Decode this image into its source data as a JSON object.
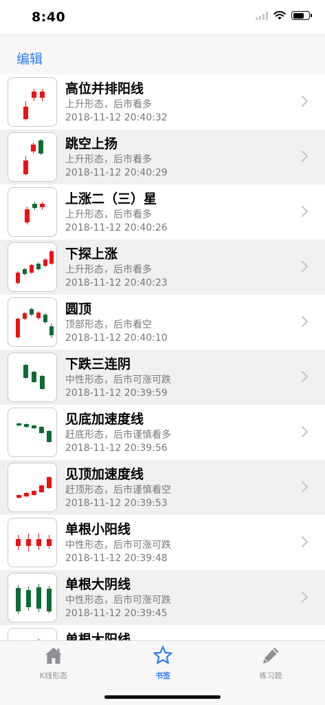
{
  "status": {
    "time": "8:40"
  },
  "nav": {
    "edit_label": "编辑"
  },
  "colors": {
    "up": "#ee1111",
    "down": "#0e6b34",
    "accent": "#2f7cf6"
  },
  "items": [
    {
      "title": "高位并排阳线",
      "subtitle": "上升形态，后市看多",
      "time": "2018-11-12 20:40:32",
      "icon": "side-by-side-white-lines-icon",
      "candles": [
        {
          "x": 22,
          "bt": 42,
          "bb": 60,
          "wt": 34,
          "wb": 62,
          "c": "up"
        },
        {
          "x": 34,
          "bt": 20,
          "bb": 29,
          "wt": 16,
          "wb": 34,
          "c": "up"
        },
        {
          "x": 46,
          "bt": 20,
          "bb": 29,
          "wt": 16,
          "wb": 34,
          "c": "up"
        }
      ]
    },
    {
      "title": "跳空上扬",
      "subtitle": "上升形态，后市看多",
      "time": "2018-11-12 20:40:29",
      "icon": "upside-gap-icon",
      "candles": [
        {
          "x": 22,
          "bt": 40,
          "bb": 60,
          "wt": 34,
          "wb": 62,
          "c": "up"
        },
        {
          "x": 33,
          "bt": 17,
          "bb": 27,
          "wt": 14,
          "wb": 30,
          "c": "up"
        },
        {
          "x": 44,
          "bt": 11,
          "bb": 30,
          "wt": 9,
          "wb": 32,
          "c": "down"
        }
      ]
    },
    {
      "title": "上涨二（三）星",
      "subtitle": "上升形态，后市看多",
      "time": "2018-11-12 20:40:26",
      "icon": "rising-stars-icon",
      "candles": [
        {
          "x": 24,
          "bt": 31,
          "bb": 50,
          "wt": 27,
          "wb": 53,
          "c": "up"
        },
        {
          "x": 35,
          "bt": 23,
          "bb": 29,
          "wt": 20,
          "wb": 32,
          "c": "down"
        },
        {
          "x": 46,
          "bt": 23,
          "bb": 28,
          "wt": 20,
          "wb": 32,
          "c": "up"
        }
      ]
    },
    {
      "title": "下探上涨",
      "subtitle": "上升形态，后市看多",
      "time": "2018-11-12 20:40:23",
      "icon": "dip-and-rise-icon",
      "candles": [
        {
          "x": 11,
          "bt": 43,
          "bb": 58,
          "wt": 41,
          "wb": 60,
          "c": "up"
        },
        {
          "x": 21,
          "bt": 38,
          "bb": 45,
          "wt": 36,
          "wb": 47,
          "c": "down"
        },
        {
          "x": 31,
          "bt": 32,
          "bb": 43,
          "wt": 30,
          "wb": 45,
          "c": "up"
        },
        {
          "x": 41,
          "bt": 30,
          "bb": 38,
          "wt": 28,
          "wb": 40,
          "c": "down"
        },
        {
          "x": 51,
          "bt": 24,
          "bb": 33,
          "wt": 22,
          "wb": 35,
          "c": "up"
        },
        {
          "x": 60,
          "bt": 12,
          "bb": 30,
          "wt": 10,
          "wb": 32,
          "c": "up"
        }
      ]
    },
    {
      "title": "圆顶",
      "subtitle": "顶部形态，后市看空",
      "time": "2018-11-12 20:40:10",
      "icon": "rounded-top-icon",
      "candles": [
        {
          "x": 11,
          "bt": 30,
          "bb": 57,
          "wt": 28,
          "wb": 59,
          "c": "up"
        },
        {
          "x": 21,
          "bt": 22,
          "bb": 30,
          "wt": 20,
          "wb": 32,
          "c": "up"
        },
        {
          "x": 31,
          "bt": 16,
          "bb": 24,
          "wt": 14,
          "wb": 26,
          "c": "down"
        },
        {
          "x": 41,
          "bt": 21,
          "bb": 29,
          "wt": 19,
          "wb": 31,
          "c": "up"
        },
        {
          "x": 51,
          "bt": 24,
          "bb": 35,
          "wt": 22,
          "wb": 37,
          "c": "down"
        },
        {
          "x": 60,
          "bt": 41,
          "bb": 54,
          "wt": 37,
          "wb": 58,
          "c": "down"
        }
      ]
    },
    {
      "title": "下跌三连阴",
      "subtitle": "中性形态，后市可涨可跌",
      "time": "2018-11-12 20:39:59",
      "icon": "three-black-crows-icon",
      "candles": [
        {
          "x": 22,
          "bt": 17,
          "bb": 36,
          "wt": 16,
          "wb": 37,
          "c": "down"
        },
        {
          "x": 34,
          "bt": 27,
          "bb": 42,
          "wt": 26,
          "wb": 43,
          "c": "down"
        },
        {
          "x": 46,
          "bt": 33,
          "bb": 52,
          "wt": 32,
          "wb": 53,
          "c": "down"
        }
      ]
    },
    {
      "title": "见底加速度线",
      "subtitle": "赶底形态，后市谨慎看多",
      "time": "2018-11-12 20:39:56",
      "icon": "bottom-acceleration-icon",
      "candles": [
        {
          "x": 12,
          "bt": 22,
          "bb": 25,
          "wt": 21,
          "wb": 26,
          "c": "down"
        },
        {
          "x": 23,
          "bt": 23,
          "bb": 27,
          "wt": 22,
          "wb": 28,
          "c": "down"
        },
        {
          "x": 34,
          "bt": 25,
          "bb": 29,
          "wt": 24,
          "wb": 30,
          "c": "down"
        },
        {
          "x": 45,
          "bt": 27,
          "bb": 36,
          "wt": 26,
          "wb": 37,
          "c": "down"
        },
        {
          "x": 56,
          "bt": 33,
          "bb": 49,
          "wt": 32,
          "wb": 50,
          "c": "down"
        }
      ]
    },
    {
      "title": "见顶加速度线",
      "subtitle": "赶顶形态，后市谨慎看空",
      "time": "2018-11-12 20:39:53",
      "icon": "top-acceleration-icon",
      "candles": [
        {
          "x": 12,
          "bt": 46,
          "bb": 50,
          "wt": 45,
          "wb": 51,
          "c": "up"
        },
        {
          "x": 23,
          "bt": 43,
          "bb": 48,
          "wt": 42,
          "wb": 49,
          "c": "up"
        },
        {
          "x": 34,
          "bt": 40,
          "bb": 46,
          "wt": 39,
          "wb": 47,
          "c": "up"
        },
        {
          "x": 45,
          "bt": 32,
          "bb": 42,
          "wt": 31,
          "wb": 43,
          "c": "up"
        },
        {
          "x": 56,
          "bt": 20,
          "bb": 36,
          "wt": 19,
          "wb": 37,
          "c": "up"
        }
      ]
    },
    {
      "title": "单根小阳线",
      "subtitle": "中性形态，后市可涨可跌",
      "time": "2018-11-12 20:39:48",
      "icon": "single-small-white-line-icon",
      "candles": [
        {
          "x": 11,
          "bt": 30,
          "bb": 40,
          "wt": 24,
          "wb": 46,
          "c": "up"
        },
        {
          "x": 26,
          "bt": 30,
          "bb": 40,
          "wt": 22,
          "wb": 48,
          "c": "up"
        },
        {
          "x": 41,
          "bt": 30,
          "bb": 40,
          "wt": 22,
          "wb": 46,
          "c": "up"
        },
        {
          "x": 56,
          "bt": 30,
          "bb": 40,
          "wt": 24,
          "wb": 44,
          "c": "up"
        }
      ]
    },
    {
      "title": "单根大阴线",
      "subtitle": "中性形态，后市可涨可跌",
      "time": "2018-11-12 20:39:45",
      "icon": "single-big-black-line-icon",
      "candles": [
        {
          "x": 11,
          "bt": 21,
          "bb": 55,
          "wt": 17,
          "wb": 59,
          "c": "down"
        },
        {
          "x": 26,
          "bt": 24,
          "bb": 49,
          "wt": 19,
          "wb": 54,
          "c": "down"
        },
        {
          "x": 41,
          "bt": 20,
          "bb": 51,
          "wt": 15,
          "wb": 56,
          "c": "down"
        },
        {
          "x": 56,
          "bt": 22,
          "bb": 55,
          "wt": 18,
          "wb": 58,
          "c": "down"
        }
      ]
    },
    {
      "title": "单根大阳线",
      "subtitle": "",
      "time": "",
      "icon": "single-big-white-line-icon",
      "candles": [
        {
          "x": 11,
          "bt": 21,
          "bb": 55,
          "wt": 17,
          "wb": 59,
          "c": "up"
        },
        {
          "x": 26,
          "bt": 24,
          "bb": 49,
          "wt": 19,
          "wb": 54,
          "c": "up"
        },
        {
          "x": 41,
          "bt": 20,
          "bb": 51,
          "wt": 15,
          "wb": 56,
          "c": "up"
        },
        {
          "x": 56,
          "bt": 22,
          "bb": 55,
          "wt": 18,
          "wb": 58,
          "c": "up"
        }
      ]
    }
  ],
  "tabs": [
    {
      "label": "K线形态",
      "icon": "home-icon",
      "active": false
    },
    {
      "label": "书签",
      "icon": "star-icon",
      "active": true
    },
    {
      "label": "练习题",
      "icon": "pencil-icon",
      "active": false
    }
  ]
}
